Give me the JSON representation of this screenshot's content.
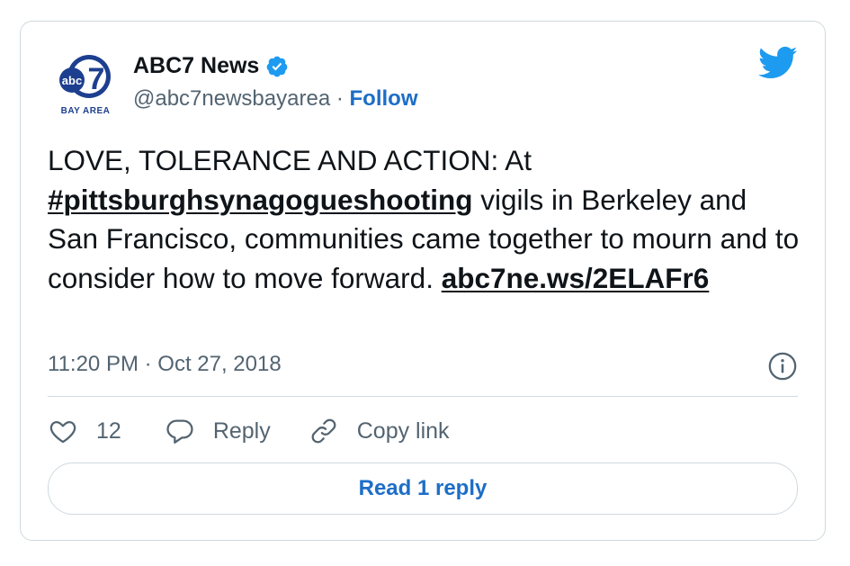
{
  "author": {
    "display_name": "ABC7 News",
    "handle": "@abc7newsbayarea",
    "separator": " · ",
    "follow_label": "Follow",
    "logo_text": "abc",
    "logo_number": "7",
    "logo_subtitle": "BAY AREA"
  },
  "tweet": {
    "text_start": "LOVE, TOLERANCE AND ACTION: At ",
    "hashtag": "#pittsburghsynagogueshooting",
    "text_end": " vigils in Berkeley and San Francisco, communities came together to mourn and to consider how to move forward. ",
    "link": "abc7ne.ws/2ELAFr6",
    "timestamp": "11:20 PM · Oct 27, 2018"
  },
  "actions": {
    "like_count": "12",
    "reply_label": "Reply",
    "copy_link_label": "Copy link"
  },
  "footer": {
    "read_replies_label": "Read 1 reply"
  },
  "colors": {
    "twitter_blue": "#1d9bf0",
    "link_blue": "#1d6ec7",
    "text": "#0f1419",
    "muted": "#536471",
    "border": "#cfd9de"
  }
}
